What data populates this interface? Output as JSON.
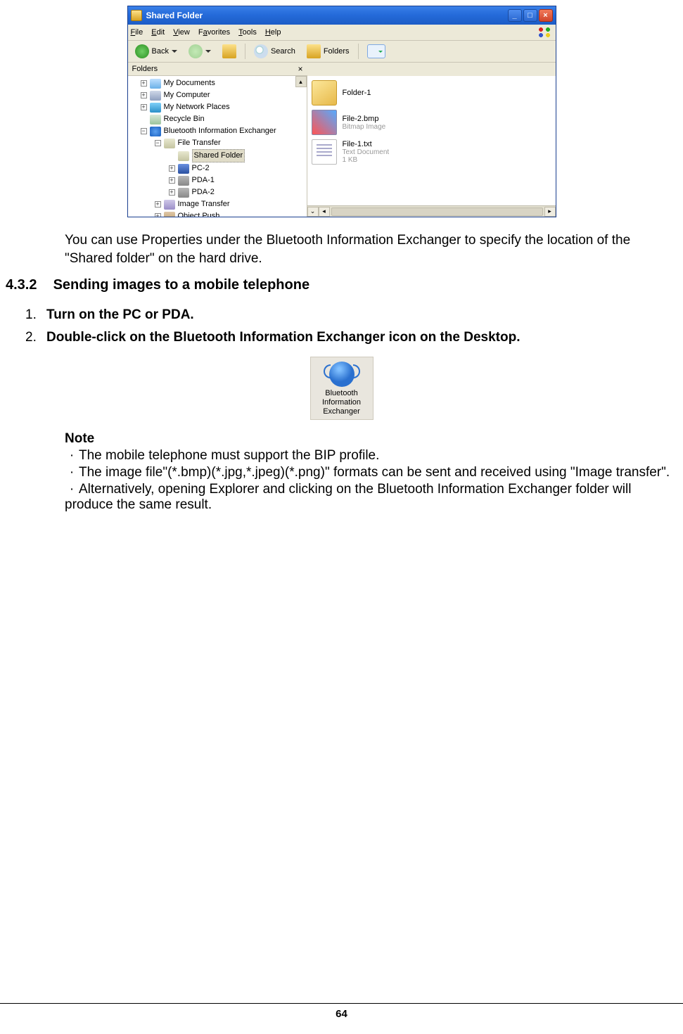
{
  "explorer": {
    "title": "Shared Folder",
    "menubar": [
      "File",
      "Edit",
      "View",
      "Favorites",
      "Tools",
      "Help"
    ],
    "toolbar": {
      "back": "Back",
      "search": "Search",
      "folders": "Folders"
    },
    "folders_pane_title": "Folders",
    "tree": [
      {
        "expand": "+",
        "icon": "docs",
        "label": "My Documents",
        "indent": 1
      },
      {
        "expand": "+",
        "icon": "comp",
        "label": "My Computer",
        "indent": 1
      },
      {
        "expand": "+",
        "icon": "net",
        "label": "My Network Places",
        "indent": 1
      },
      {
        "expand": "",
        "icon": "recy",
        "label": "Recycle Bin",
        "indent": 1
      },
      {
        "expand": "−",
        "icon": "bt",
        "label": "Bluetooth Information Exchanger",
        "indent": 1
      },
      {
        "expand": "−",
        "icon": "ft",
        "label": "File Transfer",
        "indent": 2
      },
      {
        "expand": "",
        "icon": "ft",
        "label": "Shared Folder",
        "indent": 3,
        "selected": true
      },
      {
        "expand": "+",
        "icon": "pc",
        "label": "PC-2",
        "indent": 3
      },
      {
        "expand": "+",
        "icon": "pda",
        "label": "PDA-1",
        "indent": 3
      },
      {
        "expand": "+",
        "icon": "pda",
        "label": "PDA-2",
        "indent": 3
      },
      {
        "expand": "+",
        "icon": "img",
        "label": "Image Transfer",
        "indent": 2
      },
      {
        "expand": "+",
        "icon": "push",
        "label": "Object Push",
        "indent": 2
      }
    ],
    "files": [
      {
        "icon": "folder",
        "name": "Folder-1",
        "sub": ""
      },
      {
        "icon": "bmp",
        "name": "File-2.bmp",
        "sub": "Bitmap Image"
      },
      {
        "icon": "txt",
        "name": "File-1.txt",
        "sub": "Text Document\n1 KB"
      }
    ]
  },
  "body": {
    "intro": "You can use Properties under the Bluetooth Information Exchanger to specify the location of the \"Shared folder\" on the hard drive.",
    "section_number": "4.3.2",
    "section_title": "Sending images to a mobile telephone",
    "steps": [
      {
        "n": "1.",
        "text": "Turn on the PC or PDA."
      },
      {
        "n": "2.",
        "text": "Double-click on the Bluetooth Information Exchanger icon on the Desktop."
      }
    ],
    "desktop_icon_label": "Bluetooth Information Exchanger",
    "note_heading": "Note",
    "notes": [
      "The mobile telephone must support the BIP profile.",
      "The image file\"(*.bmp)(*.jpg,*.jpeg)(*.png)\" formats can be sent and received using \"Image transfer\".",
      "Alternatively, opening Explorer and clicking on the Bluetooth Information Exchanger folder will produce the same result."
    ]
  },
  "page_number": "64"
}
